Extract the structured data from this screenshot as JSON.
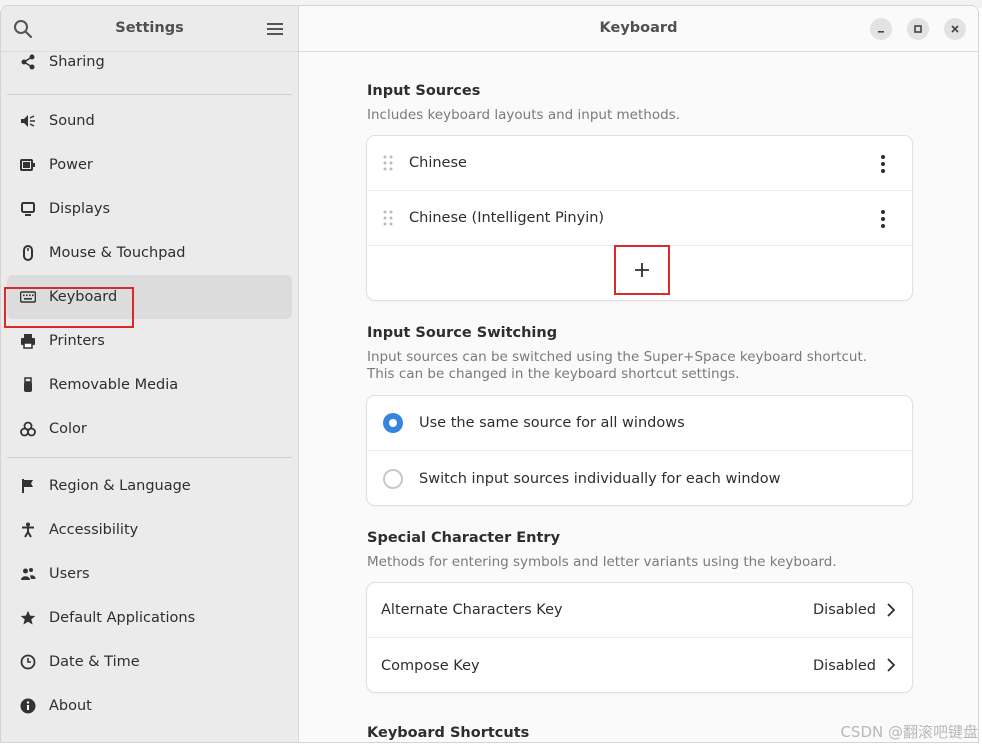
{
  "sidebar": {
    "title": "Settings",
    "items": [
      {
        "label": "Sharing",
        "icon": "share-icon"
      },
      {
        "label": "Sound",
        "icon": "speaker-icon"
      },
      {
        "label": "Power",
        "icon": "battery-icon"
      },
      {
        "label": "Displays",
        "icon": "monitor-icon"
      },
      {
        "label": "Mouse & Touchpad",
        "icon": "mouse-icon"
      },
      {
        "label": "Keyboard",
        "icon": "keyboard-icon",
        "selected": true
      },
      {
        "label": "Printers",
        "icon": "printer-icon"
      },
      {
        "label": "Removable Media",
        "icon": "usb-icon"
      },
      {
        "label": "Color",
        "icon": "color-icon"
      },
      {
        "label": "Region & Language",
        "icon": "flag-icon"
      },
      {
        "label": "Accessibility",
        "icon": "accessibility-icon"
      },
      {
        "label": "Users",
        "icon": "users-icon"
      },
      {
        "label": "Default Applications",
        "icon": "star-icon"
      },
      {
        "label": "Date & Time",
        "icon": "clock-icon"
      },
      {
        "label": "About",
        "icon": "info-icon"
      }
    ]
  },
  "main": {
    "title": "Keyboard",
    "input_sources": {
      "title": "Input Sources",
      "description": "Includes keyboard layouts and input methods.",
      "sources": [
        "Chinese",
        "Chinese (Intelligent Pinyin)"
      ]
    },
    "switching": {
      "title": "Input Source Switching",
      "description_1": "Input sources can be switched using the Super+Space keyboard shortcut.",
      "description_2": "This can be changed in the keyboard shortcut settings.",
      "options": [
        {
          "label": "Use the same source for all windows",
          "selected": true
        },
        {
          "label": "Switch input sources individually for each window",
          "selected": false
        }
      ]
    },
    "special": {
      "title": "Special Character Entry",
      "description": "Methods for entering symbols and letter variants using the keyboard.",
      "rows": [
        {
          "label": "Alternate Characters Key",
          "value": "Disabled"
        },
        {
          "label": "Compose Key",
          "value": "Disabled"
        }
      ]
    },
    "shortcuts": {
      "title": "Keyboard Shortcuts"
    }
  },
  "watermark": "CSDN @翻滚吧键盘",
  "colors": {
    "accent": "#3584e4",
    "highlight_box": "#d92a2a"
  }
}
